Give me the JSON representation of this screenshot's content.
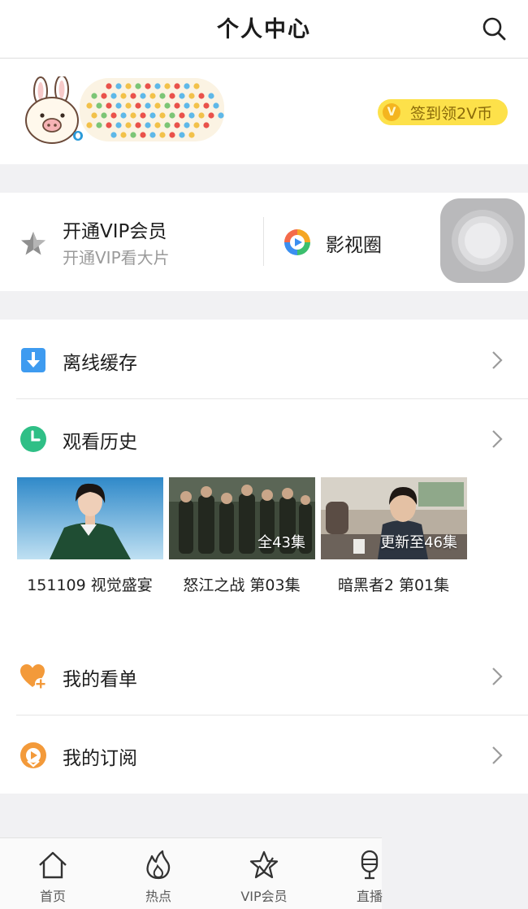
{
  "header": {
    "title": "个人中心",
    "search_icon": "search-icon"
  },
  "profile": {
    "avatar_icon": "rabbit-avatar",
    "nickname_art": "polka-dot-nickname",
    "checkin": {
      "coin_letter": "V",
      "label": "签到领2V币",
      "color": "#fde14a"
    }
  },
  "quick_actions": {
    "vip": {
      "title": "开通VIP会员",
      "subtitle": "开通VIP看大片",
      "icon": "star-icon"
    },
    "circle": {
      "label": "影视圈",
      "icon": "video-circle-icon"
    }
  },
  "menu": {
    "offline": {
      "label": "离线缓存",
      "icon": "download-icon"
    },
    "history": {
      "label": "观看历史",
      "icon": "clock-icon"
    },
    "watchlist": {
      "label": "我的看单",
      "icon": "heart-plus-icon"
    },
    "subscription": {
      "label": "我的订阅",
      "icon": "subscribe-icon"
    }
  },
  "history_items": [
    {
      "title": "151109 视觉盛宴",
      "badge": ""
    },
    {
      "title": "怒江之战 第03集",
      "badge": "全43集"
    },
    {
      "title": "暗黑者2 第01集",
      "badge": "更新至46集"
    }
  ],
  "tabs": [
    {
      "label": "首页",
      "icon": "home-icon"
    },
    {
      "label": "热点",
      "icon": "flame-icon"
    },
    {
      "label": "VIP会员",
      "icon": "vip-star-icon"
    },
    {
      "label": "直播",
      "icon": "microphone-icon"
    }
  ],
  "colors": {
    "accent_orange": "#f39a3a",
    "download_blue": "#3e9bf0",
    "history_green": "#2fbf86"
  }
}
